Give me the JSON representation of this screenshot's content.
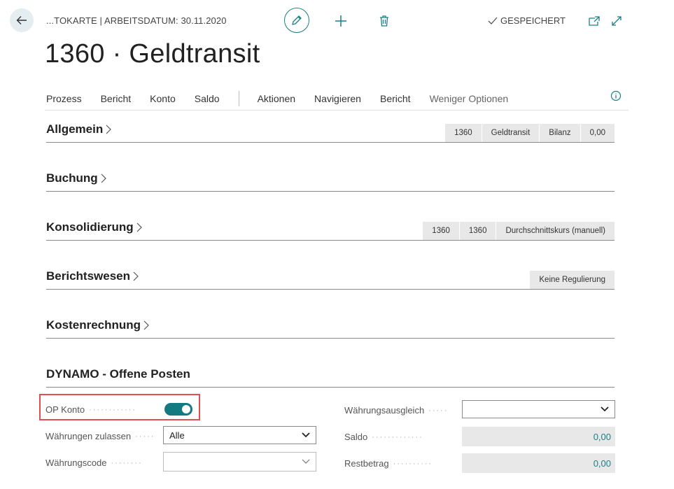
{
  "header": {
    "breadcrumb": "...TOKARTE | ARBEITSDATUM: 30.11.2020",
    "saved_label": "GESPEICHERT",
    "title": "1360 · Geldtransit"
  },
  "actions": [
    {
      "label": "Prozess"
    },
    {
      "label": "Bericht"
    },
    {
      "label": "Konto"
    },
    {
      "label": "Saldo"
    },
    {
      "label": "Aktionen"
    },
    {
      "label": "Navigieren"
    },
    {
      "label": "Bericht"
    },
    {
      "label": "Weniger Optionen"
    }
  ],
  "sections": {
    "allgemein": {
      "title": "Allgemein",
      "chips": [
        "1360",
        "Geldtransit",
        "Bilanz",
        "0,00"
      ]
    },
    "buchung": {
      "title": "Buchung"
    },
    "konsolidierung": {
      "title": "Konsolidierung",
      "chips": [
        "1360",
        "1360",
        "Durchschnittskurs (manuell)"
      ]
    },
    "berichtswesen": {
      "title": "Berichtswesen",
      "chips": [
        "Keine Regulierung"
      ]
    },
    "kostenrechnung": {
      "title": "Kostenrechnung"
    },
    "dynamo": {
      "title": "DYNAMO - Offene Posten"
    }
  },
  "fields": {
    "op_konto": {
      "label": "OP Konto",
      "value": true
    },
    "waehrungen_zulassen": {
      "label": "Währungen zulassen",
      "value": "Alle"
    },
    "waehrungscode": {
      "label": "Währungscode",
      "value": ""
    },
    "waehrungsausgleich": {
      "label": "Währungsausgleich",
      "value": ""
    },
    "saldo": {
      "label": "Saldo",
      "value": "0,00"
    },
    "restbetrag": {
      "label": "Restbetrag",
      "value": "0,00"
    }
  },
  "colors": {
    "accent": "#127a80",
    "highlight": "#e05050"
  }
}
